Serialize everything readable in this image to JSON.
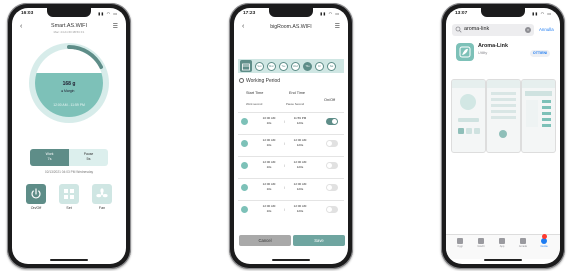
{
  "phone1": {
    "status_time": "16:03",
    "title": "Smart.AS.WIFI",
    "subtitle": "Mac: 24:A1:60:1B:5C:F1",
    "gauge": {
      "value": "168 g",
      "label": "Margin",
      "time_range": "12:00 AM - 11:59 PM",
      "fill_level": 0.65
    },
    "work": {
      "label": "Work",
      "value": "7s"
    },
    "pause": {
      "label": "Pause",
      "value": "5s"
    },
    "timestamp": "02/13/2021 04:03 PM Wednesday",
    "tiles": [
      {
        "label": "On/Off",
        "icon": "power-icon"
      },
      {
        "label": "Set",
        "icon": "grid-icon"
      },
      {
        "label": "Fan",
        "icon": "fan-icon"
      }
    ],
    "accent": "#5e8d88",
    "light": "#cfe6e3"
  },
  "phone2": {
    "status_time": "17:23",
    "title": "bigRoom.AS.WIFI",
    "days": [
      "Sun",
      "Mon",
      "Tue",
      "Wed",
      "Thu",
      "Fri",
      "Sat"
    ],
    "selected_days": [
      "Thu"
    ],
    "working_period": "Working Period",
    "col_start": "Start Time",
    "col_end": "End Time",
    "col_onoff": "On/Off",
    "sub_work": "Work second",
    "sub_pause": "Pause Second",
    "rows": [
      {
        "start": "10:00 AM",
        "start_sec": "10s",
        "end": "11:59 PM",
        "end_sec": "120s",
        "on": true
      },
      {
        "start": "12:00 AM",
        "start_sec": "10s",
        "end": "12:00 AM",
        "end_sec": "120s",
        "on": false
      },
      {
        "start": "12:00 AM",
        "start_sec": "10s",
        "end": "12:00 AM",
        "end_sec": "120s",
        "on": false
      },
      {
        "start": "12:00 AM",
        "start_sec": "10s",
        "end": "12:00 AM",
        "end_sec": "120s",
        "on": false
      },
      {
        "start": "12:00 AM",
        "start_sec": "10s",
        "end": "12:00 AM",
        "end_sec": "120s",
        "on": false
      }
    ],
    "cancel": "Cancel",
    "save": "Save"
  },
  "phone3": {
    "status_time": "13:07",
    "search_text": "aroma-link",
    "annulla": "Annulla",
    "app_name": "Aroma-Link",
    "app_category": "Utility",
    "get_label": "OTTIENI",
    "tabs": [
      {
        "label": "Oggi"
      },
      {
        "label": "Giochi"
      },
      {
        "label": "App"
      },
      {
        "label": "Arcade"
      },
      {
        "label": "Cerca"
      }
    ],
    "link_color": "#1e7cf2"
  }
}
